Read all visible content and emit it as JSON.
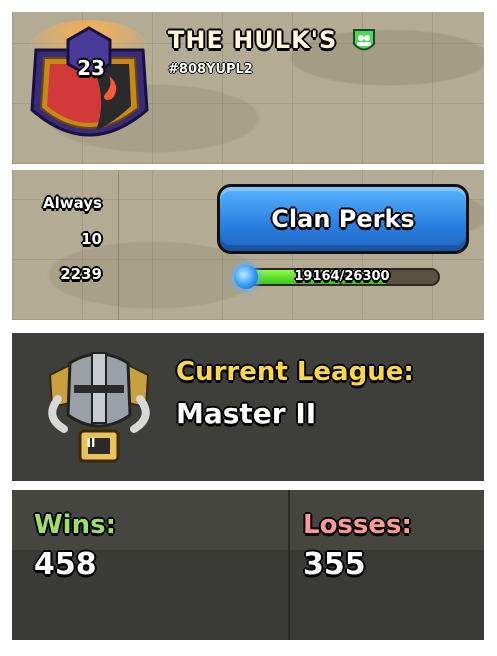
{
  "clan": {
    "level": "23",
    "name": "THE HULK'S",
    "tag": "#808YUPL2",
    "type_icon": "people-icon"
  },
  "stats": [
    {
      "value": "Always"
    },
    {
      "value": "10"
    },
    {
      "value": "2239"
    }
  ],
  "perks": {
    "button_label": "Clan Perks",
    "xp_text": "19164/26300",
    "xp_fraction": 0.7287
  },
  "league": {
    "title": "Current League:",
    "name": "Master II",
    "badge_numeral": "II"
  },
  "record": {
    "wins_label": "Wins:",
    "wins_value": "458",
    "losses_label": "Losses:",
    "losses_value": "355"
  },
  "colors": {
    "league_title": "#ffd84a",
    "wins": "#9be06a",
    "losses": "#ff9a98",
    "button_blue": "#2a7fe0",
    "xp_green": "#3cc51a"
  }
}
